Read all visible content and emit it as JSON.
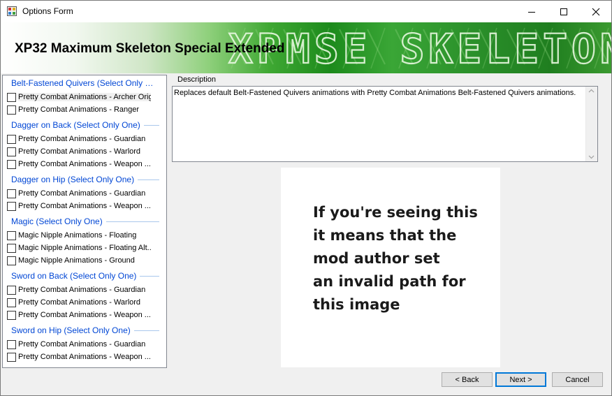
{
  "window": {
    "title": "Options Form"
  },
  "banner": {
    "title": "XP32 Maximum Skeleton Special Extended",
    "art_text": "XPMSE SKELETON"
  },
  "groups": [
    {
      "name": "Belt-Fastened Quivers (Select Only One)",
      "options": [
        {
          "label": "Pretty Combat Animations - Archer Origin",
          "checked": false,
          "selected": true
        },
        {
          "label": "Pretty Combat Animations - Ranger",
          "checked": false
        }
      ]
    },
    {
      "name": "Dagger on Back (Select Only One)",
      "options": [
        {
          "label": "Pretty Combat Animations - Guardian",
          "checked": false
        },
        {
          "label": "Pretty Combat Animations - Warlord",
          "checked": false
        },
        {
          "label": "Pretty Combat Animations - Weapon ...",
          "checked": false
        }
      ]
    },
    {
      "name": "Dagger on Hip (Select Only One)",
      "options": [
        {
          "label": "Pretty Combat Animations - Guardian",
          "checked": false
        },
        {
          "label": "Pretty Combat Animations - Weapon ...",
          "checked": false
        }
      ]
    },
    {
      "name": "Magic (Select Only One)",
      "options": [
        {
          "label": "Magic Nipple Animations - Floating",
          "checked": false
        },
        {
          "label": "Magic Nipple Animations - Floating Alt...",
          "checked": false
        },
        {
          "label": "Magic Nipple Animations - Ground",
          "checked": false
        }
      ]
    },
    {
      "name": "Sword on Back (Select Only One)",
      "options": [
        {
          "label": "Pretty Combat Animations - Guardian",
          "checked": false
        },
        {
          "label": "Pretty Combat Animations - Warlord",
          "checked": false
        },
        {
          "label": "Pretty Combat Animations - Weapon ...",
          "checked": false
        }
      ]
    },
    {
      "name": "Sword on Hip (Select Only One)",
      "options": [
        {
          "label": "Pretty Combat Animations - Guardian",
          "checked": false
        },
        {
          "label": "Pretty Combat Animations - Weapon ...",
          "checked": false
        }
      ]
    }
  ],
  "description": {
    "label": "Description",
    "text": "Replaces default Belt-Fastened Quivers animations with Pretty Combat Animations Belt-Fastened Quivers animations."
  },
  "preview": {
    "lines": [
      "If you're seeing this",
      "it means that the",
      "mod author set",
      "an invalid path for",
      "this image"
    ]
  },
  "buttons": {
    "back": "< Back",
    "next": "Next >",
    "cancel": "Cancel"
  },
  "colors": {
    "group_header": "#0046d5",
    "banner_green": "#1c8a1c",
    "default_button_border": "#0078d7"
  }
}
